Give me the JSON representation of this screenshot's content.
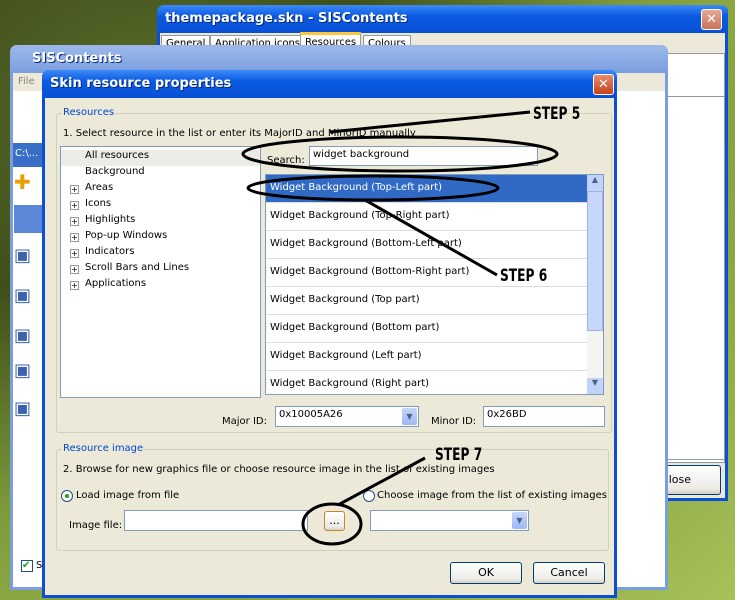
{
  "back_window": {
    "title": "themepackage.skn - SISContents",
    "tabs": [
      "General",
      "Application icons",
      "Resources",
      "Colours"
    ],
    "active_tab": "Resources",
    "close_label": "Close"
  },
  "left_window": {
    "title": "SISContents",
    "menu_file": "File",
    "path": "C:\\...",
    "checkbox_label": "SI"
  },
  "dialog": {
    "title": "Skin resource properties",
    "resources": {
      "group_label": "Resources",
      "instruction": "1. Select resource in the list or enter its MajorID and MinorID manually",
      "tree": [
        {
          "label": "All resources",
          "expandable": false
        },
        {
          "label": "Background",
          "expandable": false
        },
        {
          "label": "Areas",
          "expandable": true
        },
        {
          "label": "Icons",
          "expandable": true
        },
        {
          "label": "Highlights",
          "expandable": true
        },
        {
          "label": "Pop-up Windows",
          "expandable": true
        },
        {
          "label": "Indicators",
          "expandable": true
        },
        {
          "label": "Scroll Bars and Lines",
          "expandable": true
        },
        {
          "label": "Applications",
          "expandable": true
        }
      ],
      "search_label": "Search:",
      "search_value": "widget background",
      "list": [
        "Widget Background (Top-Left part)",
        "Widget Background (Top-Right part)",
        "Widget Background (Bottom-Left part)",
        "Widget Background (Bottom-Right part)",
        "Widget Background (Top part)",
        "Widget Background (Bottom part)",
        "Widget Background (Left part)",
        "Widget Background (Right part)"
      ],
      "selected_index": 0,
      "major_label": "Major ID:",
      "major_value": "0x10005A26",
      "minor_label": "Minor ID:",
      "minor_value": "0x26BD"
    },
    "image": {
      "group_label": "Resource image",
      "instruction": "2. Browse for new graphics file or choose resource image in the list of existing images",
      "radio_load": "Load image from file",
      "radio_choose": "Choose image from the list of existing images",
      "selected_radio": "load",
      "file_label": "Image file:",
      "file_value": "",
      "browse_label": "...",
      "existing_value": ""
    },
    "ok_label": "OK",
    "cancel_label": "Cancel"
  },
  "annotations": {
    "step5": "STEP 5",
    "step6": "STEP 6",
    "step7": "STEP 7"
  },
  "colors": {
    "titlebar": "#0a5ae3",
    "selection": "#316ac5",
    "group_label": "#0046d5"
  }
}
